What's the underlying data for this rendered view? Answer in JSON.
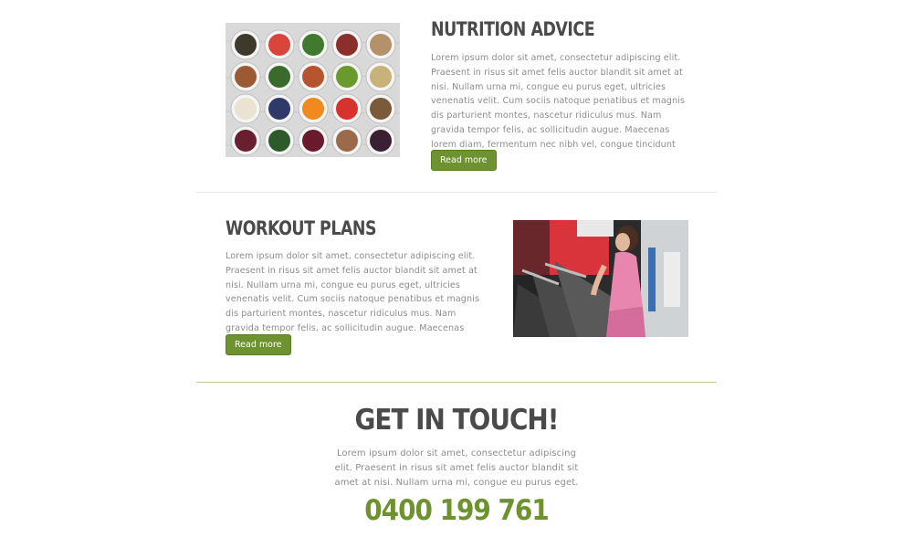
{
  "nutrition": {
    "title": "NUTRITION ADVICE",
    "text": "Lorem ipsum dolor sit amet, consectetur adipiscing elit. Praesent in risus sit amet felis auctor blandit sit amet at nisi. Nullam urna mi, congue eu purus eget, ultricies venenatis velit. Cum sociis natoque penatibus et magnis dis parturient montes, nascetur ridiculus mus. Nam gravida tempor felis, ac sollicitudin augue. Maecenas lorem diam, fermentum nec nibh vel, congue tincidunt",
    "button": "Read more",
    "image_icon": "food-bowls-photo"
  },
  "workout": {
    "title": "WORKOUT PLANS",
    "text": "Lorem ipsum dolor sit amet, consectetur adipiscing elit. Praesent in risus sit amet felis auctor blandit sit amet at nisi. Nullam urna mi, congue eu purus eget, ultricies venenatis velit. Cum sociis natoque penatibus et magnis dis parturient montes, nascetur ridiculus mus. Nam gravida tempor felis, ac sollicitudin augue. Maecenas lorem",
    "button": "Read more",
    "image_icon": "treadmill-workout-photo"
  },
  "contact": {
    "title": "GET IN TOUCH!",
    "text": "Lorem ipsum dolor sit amet, consectetur adipiscing elit. Praesent in risus sit amet felis auctor blandit sit amet at nisi. Nullam urna mi, congue eu purus eget.",
    "phone": "0400 199 761"
  },
  "colors": {
    "accent": "#6f9230",
    "heading": "#4a4a4a",
    "body_text": "#8d8d8d"
  }
}
